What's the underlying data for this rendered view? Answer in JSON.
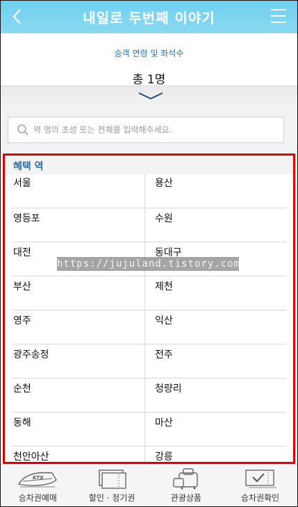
{
  "header": {
    "title": "내일로 두번째 이야기",
    "back_icon": "chevron-left-icon",
    "menu_icon": "hamburger-icon"
  },
  "passenger": {
    "label": "승객 연령 및 좌석수",
    "total": "총 1명",
    "expand_icon": "chevron-down-icon"
  },
  "search": {
    "placeholder": "역 명의 초성 또는 전체를 입력해주세요."
  },
  "station_list": {
    "header": "혜택 역",
    "rows": [
      [
        "서울",
        "용산"
      ],
      [
        "영등포",
        "수원"
      ],
      [
        "대전",
        "동대구"
      ],
      [
        "부산",
        "제천"
      ],
      [
        "영주",
        "익산"
      ],
      [
        "광주송정",
        "전주"
      ],
      [
        "순천",
        "청량리"
      ],
      [
        "동해",
        "마산"
      ],
      [
        "천안아산",
        "강릉"
      ]
    ]
  },
  "watermark": "https://jujuland.tistory.com",
  "bottom_nav": [
    {
      "label": "승차권예매",
      "icon": "ktx-train-icon"
    },
    {
      "label": "할인 · 정기권",
      "icon": "ticket-icon"
    },
    {
      "label": "관광상품",
      "icon": "luggage-icon"
    },
    {
      "label": "승차권확인",
      "icon": "ticket-check-icon"
    }
  ],
  "colors": {
    "header_bg": "#7fd5f1",
    "accent_text": "#2d6fae",
    "highlight_border": "#e00000"
  }
}
